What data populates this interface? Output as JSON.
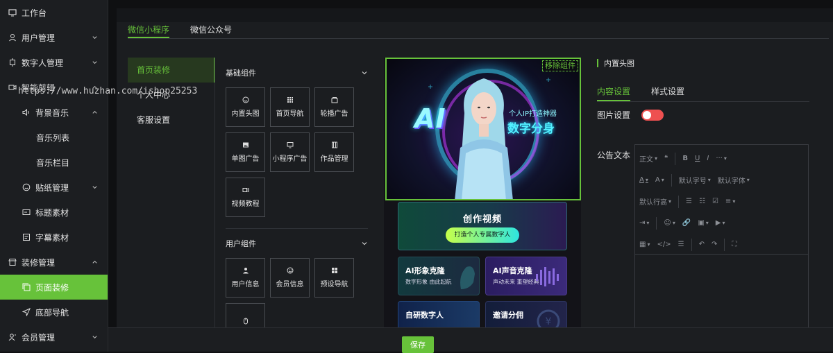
{
  "watermark": "https://www.huzhan.com/ishop25253",
  "sidebar": {
    "items": [
      {
        "label": "工作台"
      },
      {
        "label": "用户管理"
      },
      {
        "label": "数字人管理"
      },
      {
        "label": "智能剪辑"
      },
      {
        "label": "背景音乐"
      },
      {
        "label": "音乐列表"
      },
      {
        "label": "音乐栏目"
      },
      {
        "label": "贴纸管理"
      },
      {
        "label": "标题素材"
      },
      {
        "label": "字幕素材"
      },
      {
        "label": "装修管理"
      },
      {
        "label": "页面装修"
      },
      {
        "label": "底部导航"
      },
      {
        "label": "会员管理"
      }
    ]
  },
  "tabs": [
    "微信小程序",
    "微信公众号"
  ],
  "submenu": [
    "首页装修",
    "个人中心",
    "客服设置"
  ],
  "palette": {
    "basic": {
      "title": "基础组件",
      "items": [
        "内置头图",
        "首页导航",
        "轮播广告",
        "单图广告",
        "小程序广告",
        "作品管理",
        "视频教程"
      ]
    },
    "user": {
      "title": "用户组件",
      "items": [
        "用户信息",
        "会员信息",
        "预设导航"
      ]
    }
  },
  "preview": {
    "remove": "移除组件",
    "hero_ai": "AI",
    "hero_slogan": "个人IP打造神器",
    "hero_title": "数字分身",
    "create_title": "创作视频",
    "create_button": "打造个人专属数字人",
    "features": [
      {
        "title": "AI形象克隆",
        "sub": "数字形象 由此起航"
      },
      {
        "title": "AI声音克隆",
        "sub": "声动未来 重塑经典"
      },
      {
        "title": "自研数字人",
        "sub": ""
      },
      {
        "title": "邀请分佣",
        "sub": ""
      }
    ]
  },
  "settings": {
    "title": "内置头图",
    "subtabs": [
      "内容设置",
      "样式设置"
    ],
    "image_label": "图片设置",
    "notice_label": "公告文本",
    "toolbar": {
      "r1": [
        "正文",
        "❝",
        "B",
        "U",
        "I",
        "···"
      ],
      "r2": [
        "A",
        "A",
        "默认字号",
        "默认字体"
      ],
      "r3": [
        "默认行高",
        "☰",
        "☷",
        "☑",
        "≡"
      ],
      "r4": [
        "⇥",
        "☺",
        "🔗",
        "▣",
        "▶"
      ],
      "r5": [
        "▦",
        "</>",
        "☰",
        "↶",
        "↷",
        "⛶"
      ]
    }
  },
  "footer": {
    "save": "保存"
  },
  "colors": {
    "accent": "#67c23a",
    "switch_off": "#ee5050"
  }
}
